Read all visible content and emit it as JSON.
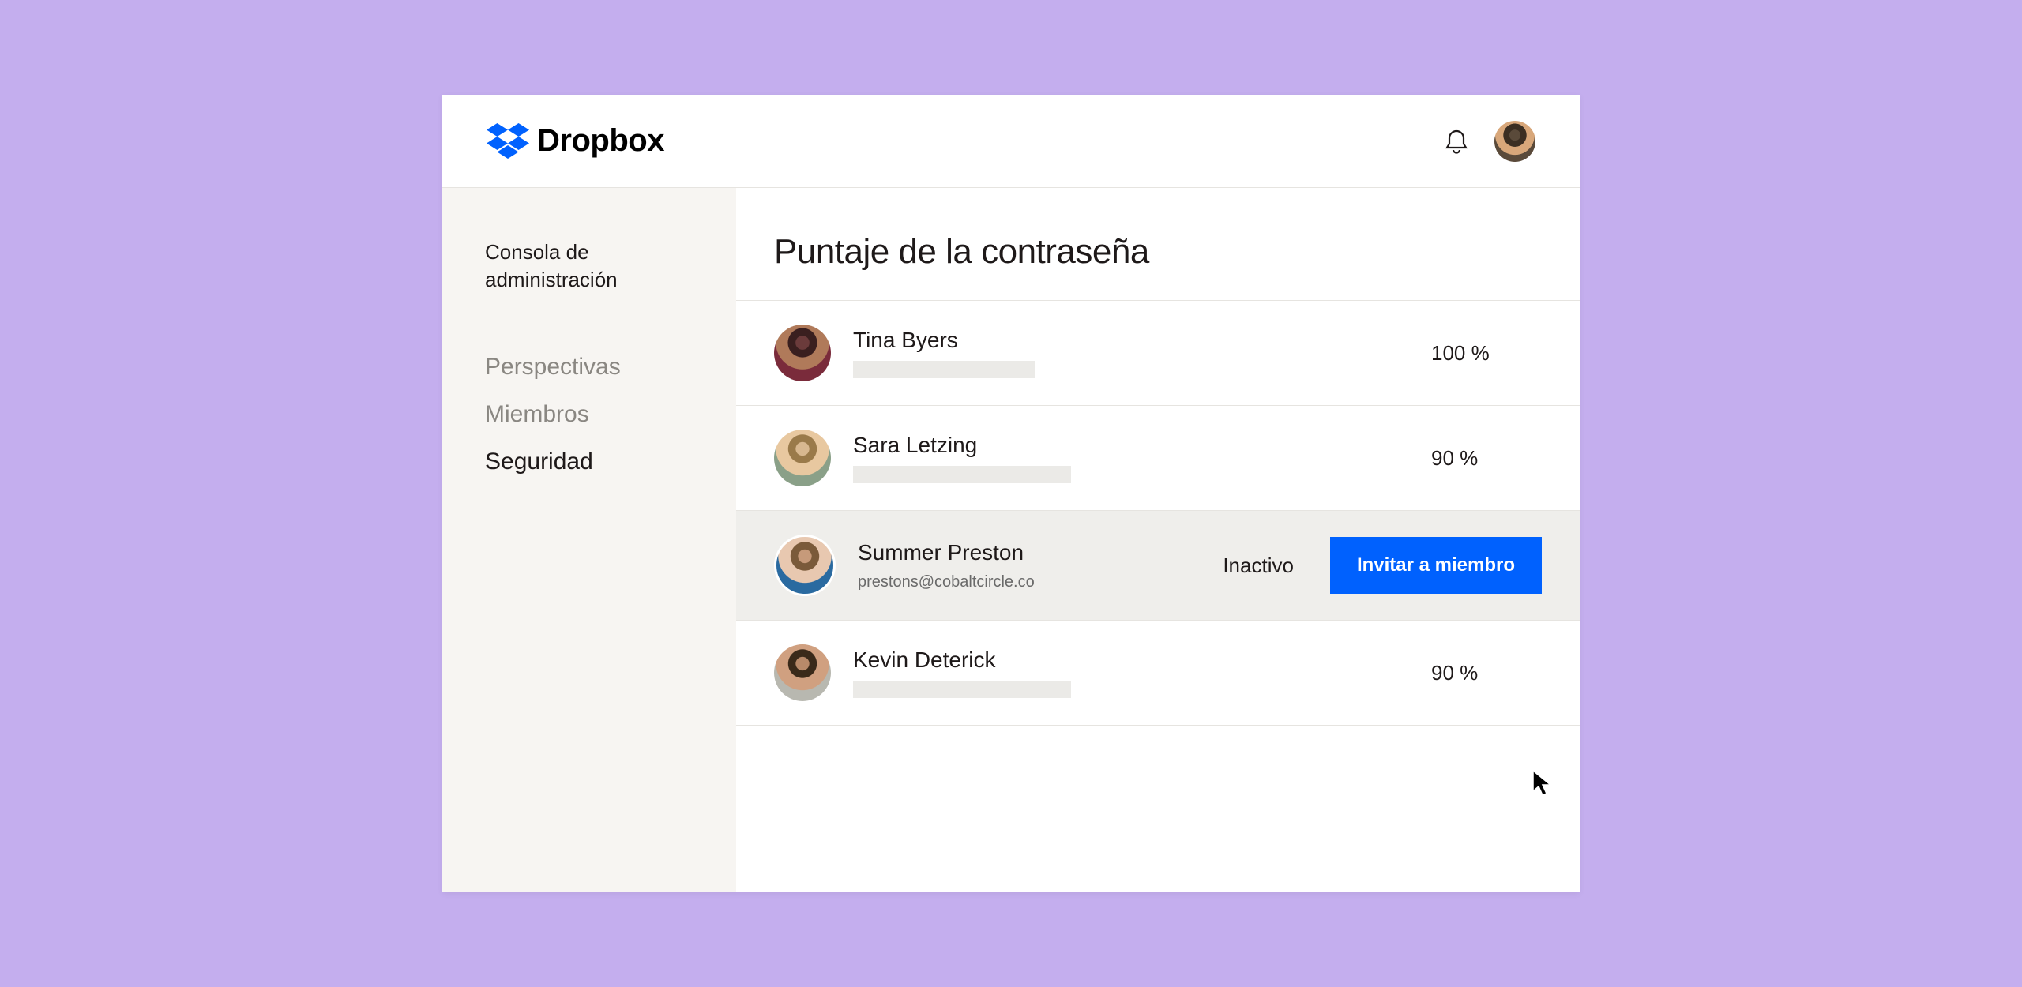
{
  "brand": {
    "name": "Dropbox"
  },
  "sidebar": {
    "title": "Consola de administración",
    "items": [
      {
        "label": "Perspectivas",
        "active": false
      },
      {
        "label": "Miembros",
        "active": false
      },
      {
        "label": "Seguridad",
        "active": true
      }
    ]
  },
  "main": {
    "title": "Puntaje de la contraseña",
    "rows": [
      {
        "name": "Tina Byers",
        "score": "100 %"
      },
      {
        "name": "Sara Letzing",
        "score": "90 %"
      },
      {
        "name": "Summer Preston",
        "email": "prestons@cobaltcircle.co",
        "status": "Inactivo",
        "action": "Invitar a miembro"
      },
      {
        "name": "Kevin Deterick",
        "score": "90 %"
      }
    ]
  }
}
